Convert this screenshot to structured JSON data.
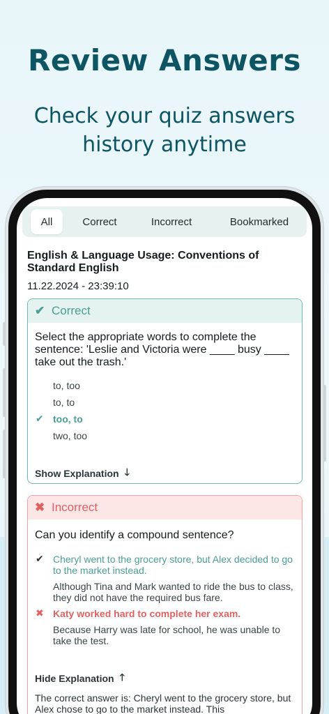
{
  "promo": {
    "title": "Review Answers",
    "subtitle_line1": "Check your quiz answers",
    "subtitle_line2": "history anytime"
  },
  "tabs": [
    {
      "label": "All",
      "active": true
    },
    {
      "label": "Correct",
      "active": false
    },
    {
      "label": "Incorrect",
      "active": false
    },
    {
      "label": "Bookmarked",
      "active": false
    }
  ],
  "quiz": {
    "title": "English & Language Usage: Conventions of Standard English",
    "date": "11.22.2024 - 23:39:10"
  },
  "card_correct": {
    "status": "Correct",
    "status_icon": "check-icon",
    "question": "Select the appropriate words to complete the sentence: 'Leslie and Victoria were ____ busy ____ take out the trash.'",
    "options": [
      "to, too",
      "to, to",
      "too, to",
      "two, too"
    ],
    "selected_option_index": 2,
    "toggle_label": "Show Explanation"
  },
  "card_incorrect": {
    "status": "Incorrect",
    "status_icon": "x-icon",
    "question": "Can you identify a compound sentence?",
    "options": [
      "Cheryl went to the grocery store, but Alex decided to go to the market instead.",
      "Although Tina and Mark wanted to ride the bus to class, they did not have the required bus fare.",
      "Katy worked hard to complete her exam.",
      "Because Harry was late for school, he was unable to take the test."
    ],
    "correct_option_index": 0,
    "selected_option_index": 2,
    "toggle_label": "Hide Explanation",
    "explanation": "The correct answer is: Cheryl went to the grocery store, but Alex chose to go to the market instead. This"
  },
  "colors": {
    "brand_dark": "#0d5563",
    "correct": "#4a9e93",
    "incorrect": "#e06161"
  }
}
